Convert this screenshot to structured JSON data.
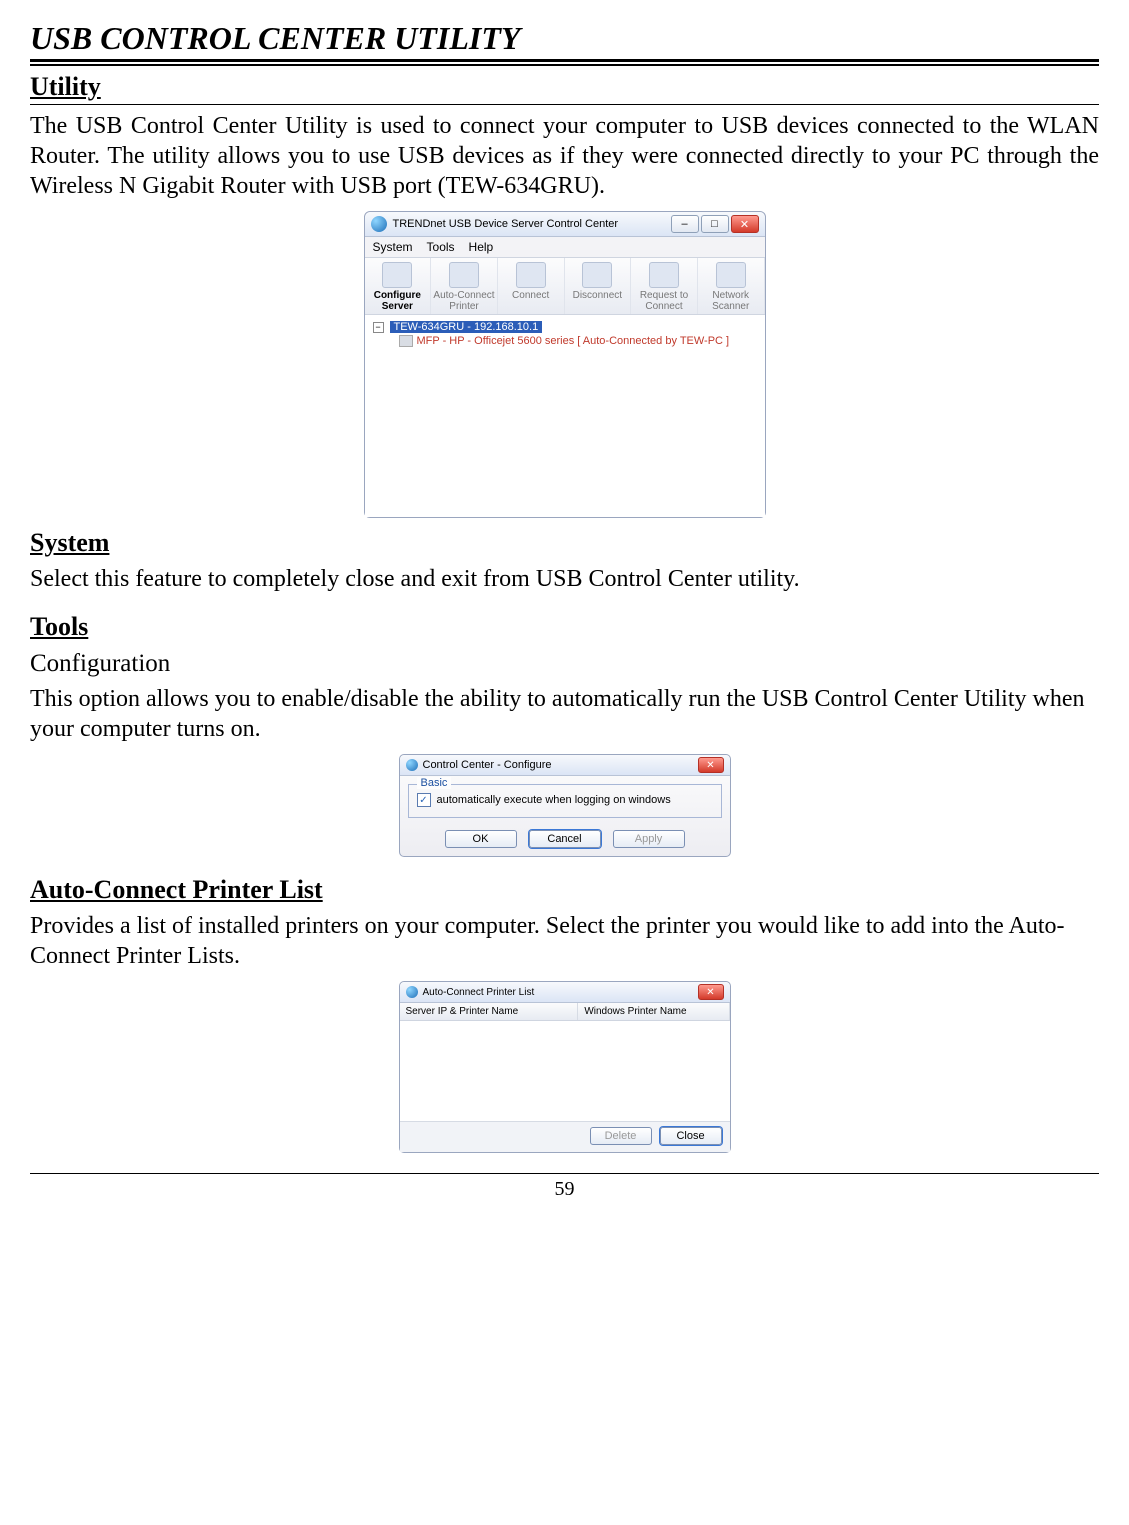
{
  "page": {
    "title": "USB CONTROL CENTER UTILITY",
    "pageNumber": "59"
  },
  "utility": {
    "heading": "Utility",
    "paragraph": "The USB Control Center Utility is used to connect your computer to USB devices connected to the WLAN Router. The utility allows you to use USB devices as if they were connected directly to your PC through the Wireless N Gigabit Router with USB port (TEW-634GRU)."
  },
  "app_window": {
    "title": "TRENDnet USB Device Server Control Center",
    "menus": [
      "System",
      "Tools",
      "Help"
    ],
    "toolbar": [
      {
        "label": "Configure Server"
      },
      {
        "label": "Auto-Connect Printer"
      },
      {
        "label": "Connect"
      },
      {
        "label": "Disconnect"
      },
      {
        "label": "Request to Connect"
      },
      {
        "label": "Network Scanner"
      }
    ],
    "tree": {
      "root": "TEW-634GRU - 192.168.10.1",
      "child": "MFP - HP - Officejet 5600 series [ Auto-Connected by TEW-PC ]"
    },
    "window_controls": {
      "min": "–",
      "max": "□",
      "close": "✕"
    }
  },
  "system": {
    "heading": "System",
    "paragraph": "Select this feature to completely close and exit from USB Control Center utility."
  },
  "tools": {
    "heading": "Tools",
    "sub": "Configuration",
    "paragraph": "This option allows you to enable/disable the ability to automatically run the USB Control Center Utility when your computer turns on."
  },
  "config_dialog": {
    "title": "Control Center - Configure",
    "group": "Basic",
    "checkbox_label": "automatically execute when logging on windows",
    "buttons": {
      "ok": "OK",
      "cancel": "Cancel",
      "apply": "Apply"
    },
    "close": "✕"
  },
  "autoconnect": {
    "heading": "Auto-Connect Printer List",
    "paragraph": "Provides a list of installed printers on your computer. Select the printer you would like to add into the Auto-Connect Printer Lists."
  },
  "acpl_dialog": {
    "title": "Auto-Connect Printer List",
    "col1": "Server IP & Printer Name",
    "col2": "Windows Printer Name",
    "buttons": {
      "delete": "Delete",
      "close": "Close"
    },
    "closeX": "✕"
  }
}
